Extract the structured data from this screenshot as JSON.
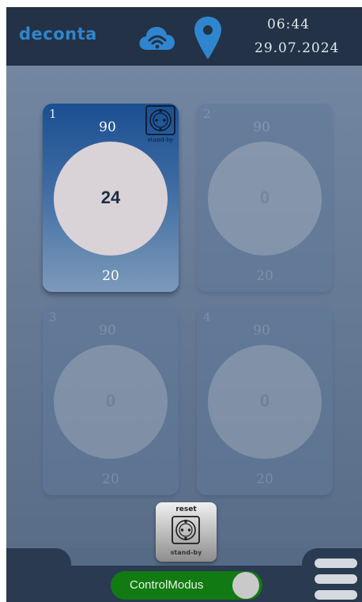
{
  "header": {
    "logo": "deconta",
    "time": "06:44",
    "date": "29.07.2024",
    "icons": [
      "cloud-wifi-icon",
      "location-pin-icon"
    ]
  },
  "colors": {
    "accent": "#2f86cf",
    "toggle_on": "#127a12",
    "header_bg": "#233246"
  },
  "tiles": [
    {
      "number": "1",
      "max": "90",
      "value": "24",
      "min": "20",
      "status": "stand-by",
      "active": true
    },
    {
      "number": "2",
      "max": "90",
      "value": "0",
      "min": "20",
      "active": false
    },
    {
      "number": "3",
      "max": "90",
      "value": "0",
      "min": "20",
      "active": false
    },
    {
      "number": "4",
      "max": "90",
      "value": "0",
      "min": "20",
      "active": false
    }
  ],
  "reset_button": {
    "label": "reset",
    "sublabel": "stand-by"
  },
  "footer": {
    "toggle_label": "ControlModus",
    "toggle_on": true,
    "menu_icon": "hamburger-menu-icon"
  }
}
